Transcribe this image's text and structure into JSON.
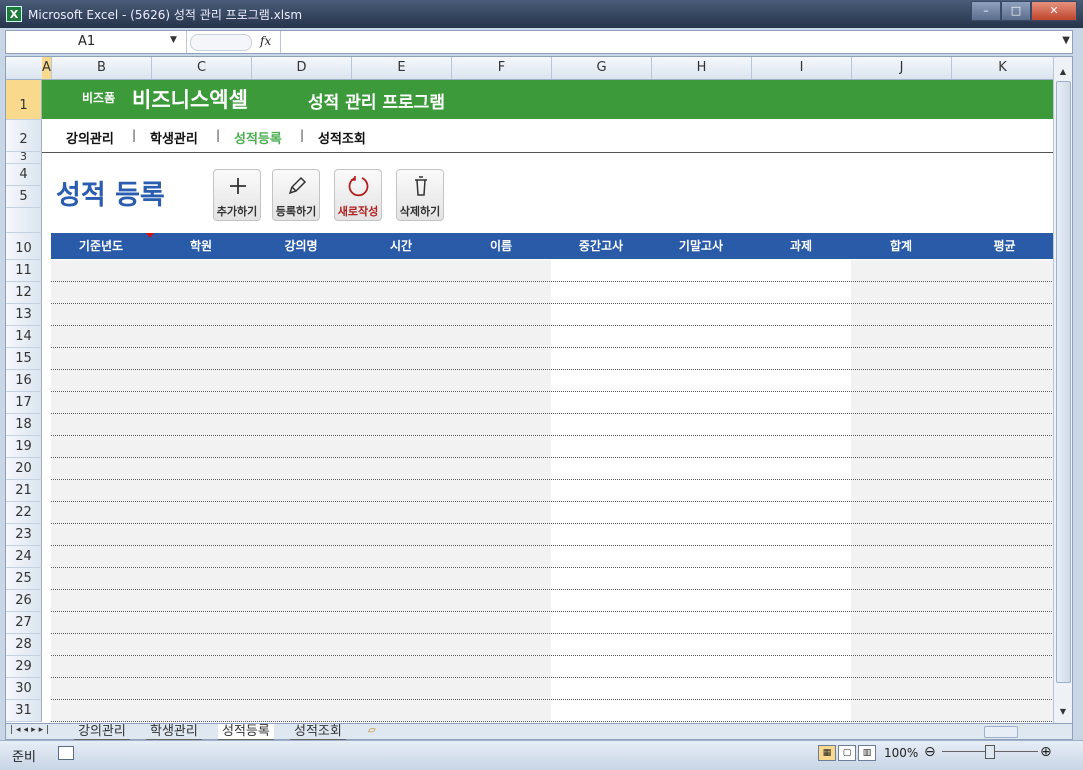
{
  "window": {
    "app_icon": "X",
    "title": "Microsoft Excel - (5626) 성적 관리 프로그램.xlsm",
    "minimize": "–",
    "maximize": "□",
    "close": "✕"
  },
  "formula_bar": {
    "cell_ref": "A1",
    "fx_label": "fx",
    "formula_value": ""
  },
  "columns": [
    "A",
    "B",
    "C",
    "D",
    "E",
    "F",
    "G",
    "H",
    "I",
    "J",
    "K"
  ],
  "rows": [
    "1",
    "2",
    "3",
    "4",
    "5",
    "10",
    "11",
    "12",
    "13",
    "14",
    "15",
    "16",
    "17",
    "18",
    "19",
    "20",
    "21",
    "22",
    "23",
    "24",
    "25",
    "26",
    "27",
    "28",
    "29",
    "30",
    "31"
  ],
  "banner": {
    "brand_small": "비즈폼",
    "brand": "비즈니스엑셀",
    "title": "성적 관리 프로그램"
  },
  "nav": [
    "강의관리",
    "학생관리",
    "성적등록",
    "성적조회"
  ],
  "nav_active": "성적등록",
  "page_title": "성적 등록",
  "buttons": [
    {
      "label": "추가하기",
      "icon": "plus-icon"
    },
    {
      "label": "등록하기",
      "icon": "pencil-icon"
    },
    {
      "label": "새로작성",
      "icon": "refresh-icon"
    },
    {
      "label": "삭제하기",
      "icon": "trash-icon"
    }
  ],
  "table": {
    "headers": [
      "기준년도",
      "학원",
      "강의명",
      "시간",
      "이름",
      "중간고사",
      "기말고사",
      "과제",
      "합계",
      "평균"
    ]
  },
  "sheet_tabs": [
    "강의관리",
    "학생관리",
    "성적등록",
    "성적조회"
  ],
  "active_tab": "성적등록",
  "status": {
    "ready": "준비",
    "zoom": "100%"
  },
  "colors": {
    "banner_green": "#3c9a3a",
    "header_blue": "#2a5ba8",
    "title_blue": "#2a5cb0",
    "active_nav_green": "#4caf50"
  }
}
